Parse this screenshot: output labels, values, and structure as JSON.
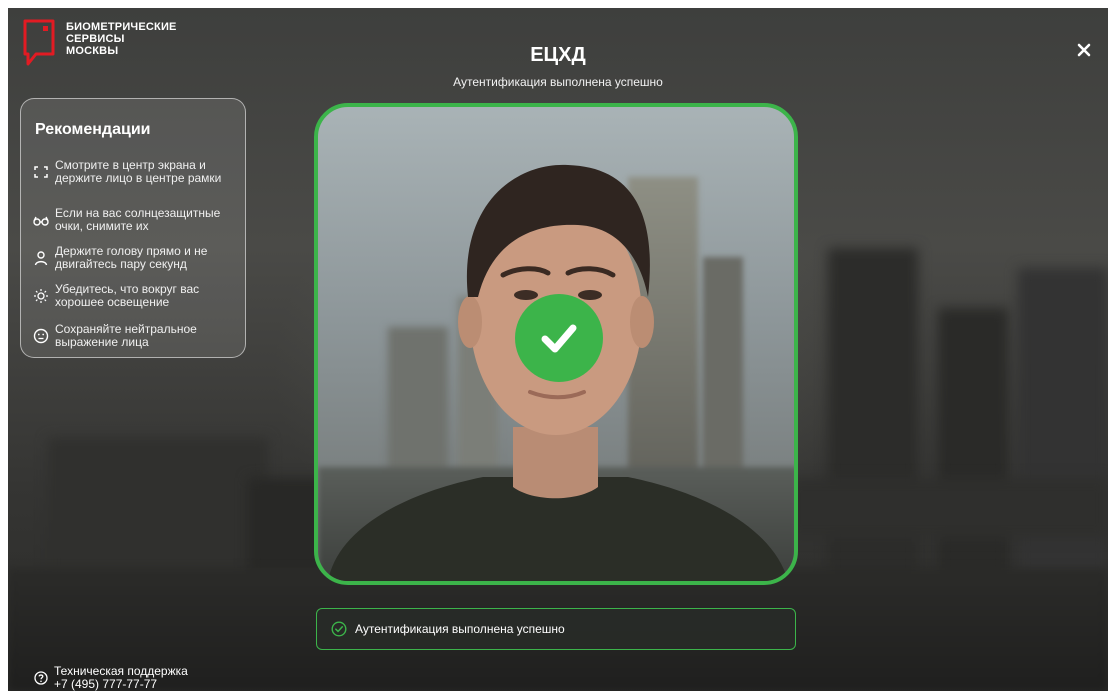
{
  "logo": {
    "lines": [
      "БИОМЕТРИЧЕСКИЕ",
      "СЕРВИСЫ",
      "МОСКВЫ"
    ],
    "brand_color": "#e21b23",
    "icon": "location-pin-icon"
  },
  "header": {
    "title": "ЕЦХД",
    "subtitle": "Аутентификация выполнена успешно",
    "close_icon": "close-icon"
  },
  "recommendations": {
    "title": "Рекомендации",
    "items": [
      {
        "icon": "face-frame-icon",
        "text": "Смотрите в центр экрана и\nдержите лицо в центре рамки"
      },
      {
        "icon": "sunglasses-icon",
        "text": "Если на вас солнцезащитные\nочки, снимите их"
      },
      {
        "icon": "person-icon",
        "text": "Держите голову прямо и не\nдвигайтесь пару секунд"
      },
      {
        "icon": "sun-icon",
        "text": "Убедитесь, что вокруг вас\nхорошее освещение"
      },
      {
        "icon": "neutral-face-icon",
        "text": "Сохраняйте нейтральное\nвыражение лица"
      }
    ]
  },
  "camera": {
    "frame_color": "#3cb44a",
    "success_icon": "check-icon"
  },
  "status": {
    "icon": "check-circle-icon",
    "text": "Аутентификация выполнена успешно",
    "color": "#3cb44a"
  },
  "support": {
    "icon": "question-circle-icon",
    "label": "Техническая поддержка",
    "phone": "+7 (495) 777-77-77"
  }
}
